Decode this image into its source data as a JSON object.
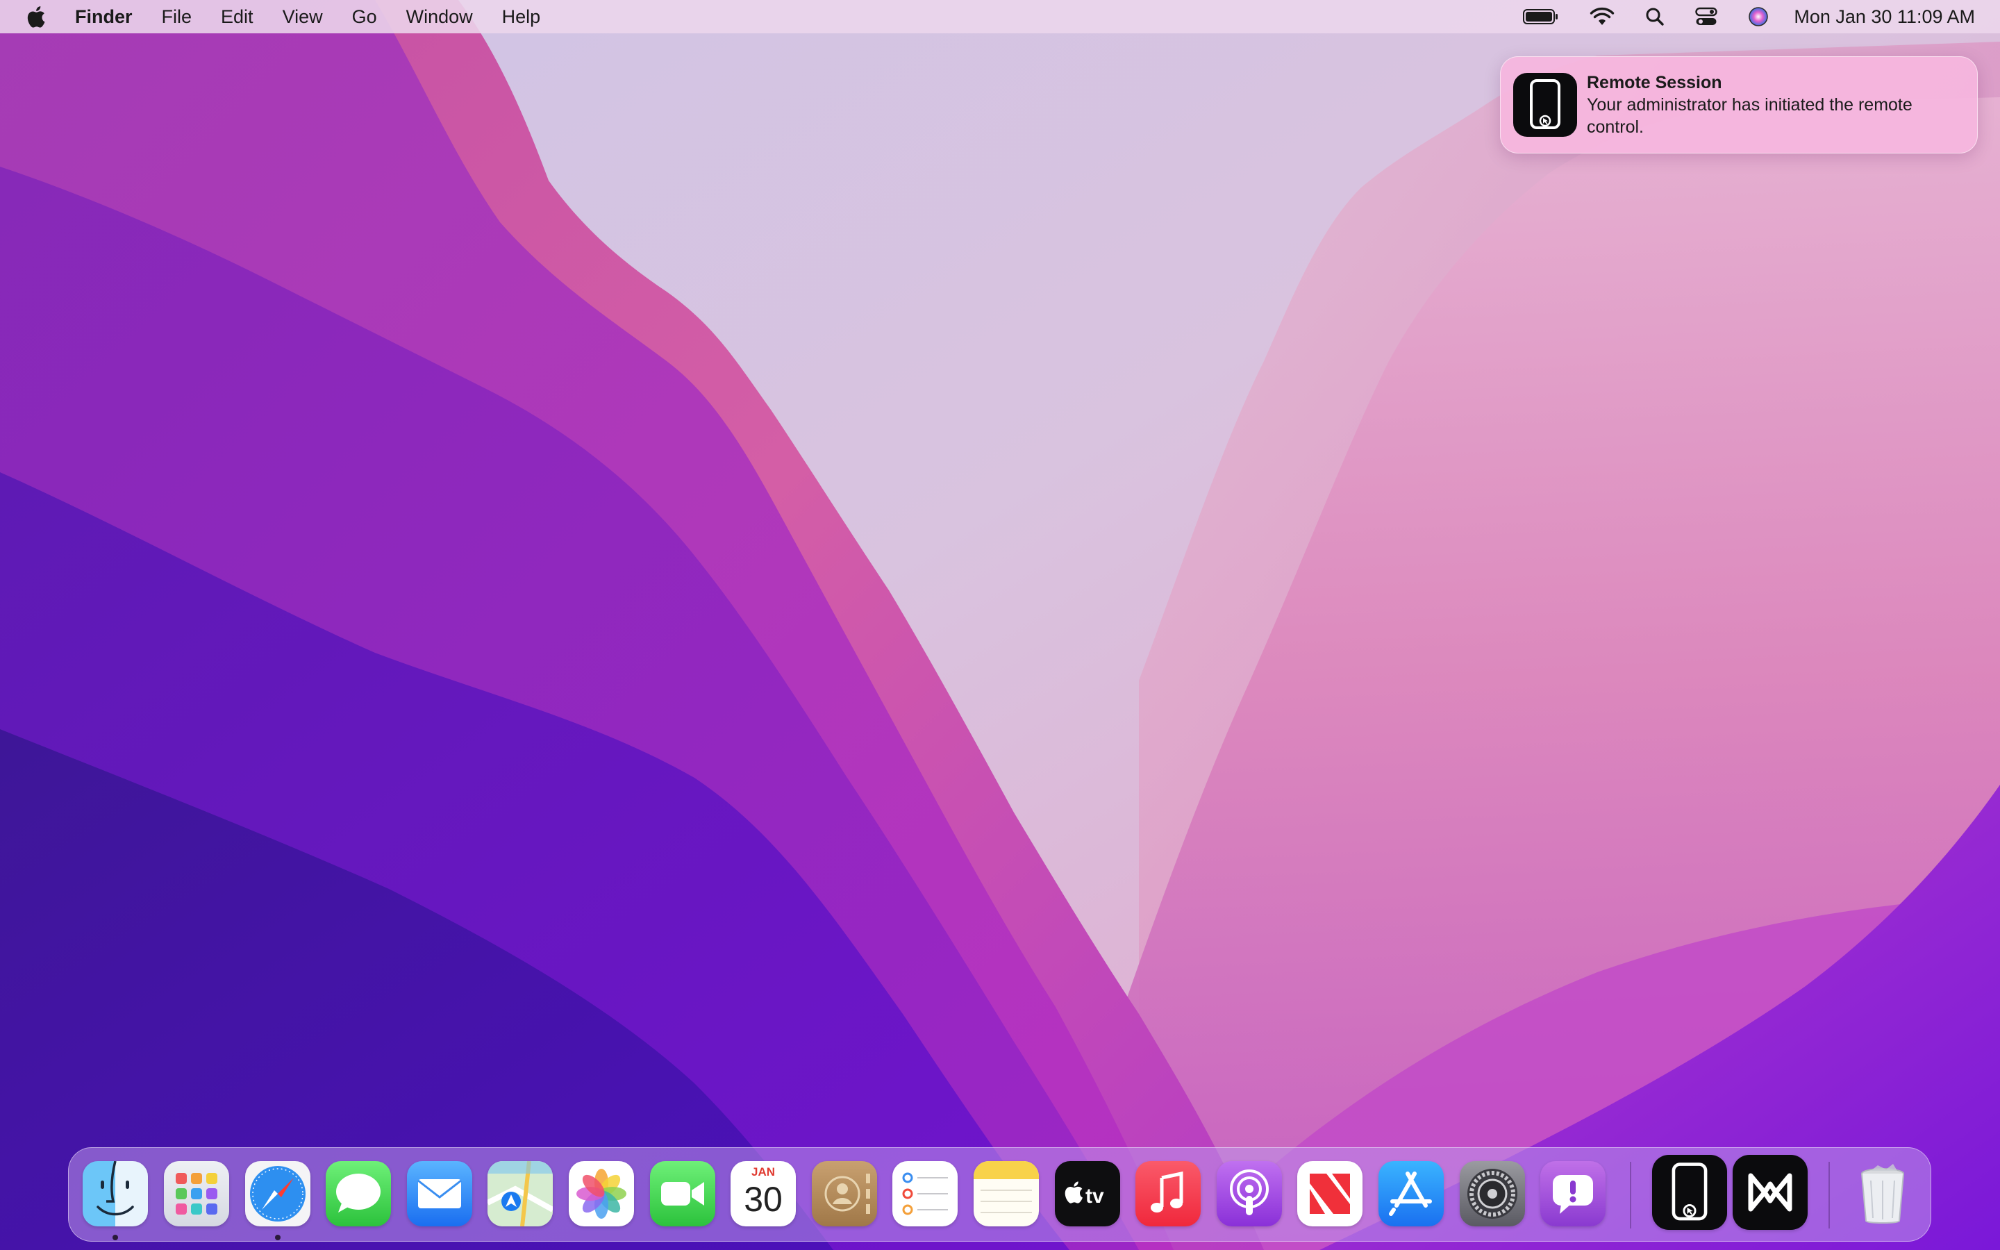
{
  "menubar": {
    "apple_icon": "apple-logo",
    "app_name": "Finder",
    "menus": [
      "File",
      "Edit",
      "View",
      "Go",
      "Window",
      "Help"
    ],
    "status_icons": [
      "battery-icon",
      "wifi-icon",
      "spotlight-search-icon",
      "control-center-icon",
      "siri-icon"
    ],
    "clock": "Mon Jan 30  11:09 AM"
  },
  "notification": {
    "app_icon": "remote-session-icon",
    "title": "Remote Session",
    "body": "Your administrator has initiated the remote control."
  },
  "dock": {
    "apps": [
      {
        "name": "Finder",
        "icon": "finder-icon",
        "running": true
      },
      {
        "name": "Launchpad",
        "icon": "launchpad-icon",
        "running": false
      },
      {
        "name": "Safari",
        "icon": "safari-icon",
        "running": true
      },
      {
        "name": "Messages",
        "icon": "messages-icon",
        "running": false
      },
      {
        "name": "Mail",
        "icon": "mail-icon",
        "running": false
      },
      {
        "name": "Maps",
        "icon": "maps-icon",
        "running": false
      },
      {
        "name": "Photos",
        "icon": "photos-icon",
        "running": false
      },
      {
        "name": "FaceTime",
        "icon": "facetime-icon",
        "running": false
      },
      {
        "name": "Calendar",
        "icon": "calendar-icon",
        "running": false,
        "month": "JAN",
        "day": "30"
      },
      {
        "name": "Contacts",
        "icon": "contacts-icon",
        "running": false
      },
      {
        "name": "Reminders",
        "icon": "reminders-icon",
        "running": false
      },
      {
        "name": "Notes",
        "icon": "notes-icon",
        "running": false
      },
      {
        "name": "TV",
        "icon": "apple-tv-icon",
        "running": false,
        "label": "tv"
      },
      {
        "name": "Music",
        "icon": "music-icon",
        "running": false
      },
      {
        "name": "Podcasts",
        "icon": "podcasts-icon",
        "running": false
      },
      {
        "name": "News",
        "icon": "news-icon",
        "running": false
      },
      {
        "name": "App Store",
        "icon": "app-store-icon",
        "running": false
      },
      {
        "name": "System Settings",
        "icon": "system-settings-icon",
        "running": false
      },
      {
        "name": "Feedback Assistant",
        "icon": "feedback-assistant-icon",
        "running": false
      }
    ],
    "recent_apps": [
      {
        "name": "Remote Session",
        "icon": "remote-session-icon"
      },
      {
        "name": "Remote Control Agent",
        "icon": "infinity-logo-icon"
      }
    ],
    "trash": {
      "name": "Trash",
      "icon": "trash-icon"
    }
  },
  "colors": {
    "wallpaper_top": "#d8c8e4",
    "wallpaper_pink": "#c04ab0",
    "wallpaper_violet": "#5a18c8",
    "notification_bg": "#f6b6de",
    "menubar_bg": "#ecd6ec"
  }
}
